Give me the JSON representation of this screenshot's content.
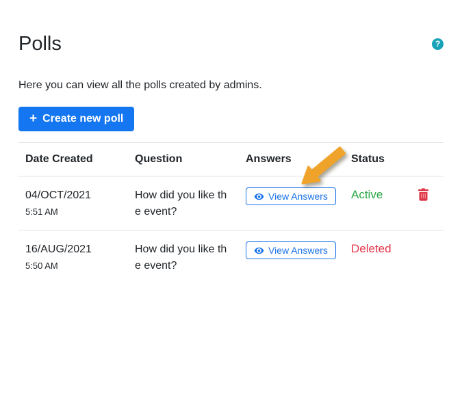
{
  "page": {
    "title": "Polls",
    "subtitle": "Here you can view all the polls created by admins.",
    "help_glyph": "?",
    "create_button": {
      "label": "Create new poll",
      "icon_glyph": "+"
    }
  },
  "table": {
    "headers": [
      "Date Created",
      "Question",
      "Answers",
      "Status"
    ],
    "rows": [
      {
        "date": "04/OCT/2021",
        "time": "5:51 AM",
        "question": "How did you like the event?",
        "question_lines": [
          "How did you like th",
          "e event?"
        ],
        "answers_label": "View Answers",
        "status": "Active",
        "status_color": "#28a745",
        "has_delete": true
      },
      {
        "date": "16/AUG/2021",
        "time": "5:50 AM",
        "question": "How did you like the event?",
        "question_lines": [
          "How did you like th",
          "e event?"
        ],
        "answers_label": "View Answers",
        "status": "Deleted",
        "status_color": "#e4354b",
        "has_delete": false
      }
    ]
  },
  "annotation": {
    "type": "arrow",
    "color": "#f0a32a",
    "points_to": "view-answers-button of first row"
  },
  "colors": {
    "primary_blue": "#1476f0",
    "link_blue": "#1a73e8",
    "active_green": "#28a745",
    "deleted_red": "#e4354b",
    "danger_red": "#dc3545",
    "help_teal": "#17a2b8",
    "arrow_yellow": "#f0a32a",
    "border_gray": "#dee2e6",
    "text_dark": "#212529"
  }
}
